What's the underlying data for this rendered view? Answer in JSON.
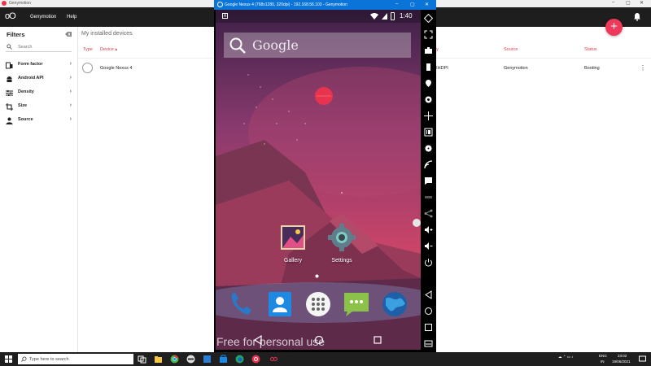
{
  "genymotion": {
    "window_title": "Genymotion",
    "brand": "oO",
    "menu": [
      "Genymotion",
      "Help"
    ],
    "sidebar": {
      "title": "Filters",
      "search_placeholder": "Search",
      "filters": [
        {
          "label": "Form factor",
          "icon": "phone-tablet-icon"
        },
        {
          "label": "Android API",
          "icon": "android-icon"
        },
        {
          "label": "Density",
          "icon": "sliders-icon"
        },
        {
          "label": "Size",
          "icon": "crop-icon"
        },
        {
          "label": "Source",
          "icon": "person-icon"
        }
      ]
    },
    "main": {
      "heading": "My installed devices",
      "columns": {
        "type": "Type",
        "device": "Device ▴",
        "density": "y",
        "source": "Source",
        "status": "Status"
      },
      "rows": [
        {
          "device": "Google Nexus 4",
          "density": "XHDPI",
          "source": "Genymotion",
          "status": "Booting"
        }
      ]
    },
    "fab_label": "+",
    "accent_color": "#f0385a"
  },
  "emulator": {
    "window_title": "Google Nexus 4 (768x1280, 320dpi) - 192.168.56.103 - Genymotion",
    "title_bar_color": "#0a74d8",
    "status_time": "1:40",
    "search_text": "Google",
    "apps": [
      {
        "label": "Gallery",
        "icon": "gallery-icon"
      },
      {
        "label": "Settings",
        "icon": "settings-gear-icon"
      }
    ],
    "dock": [
      "phone-icon",
      "contacts-icon",
      "app-drawer-icon",
      "messaging-icon",
      "browser-globe-icon"
    ],
    "watermark": "Free for personal use"
  },
  "taskbar": {
    "search_placeholder": "Type here to search",
    "lang_line1": "ENG",
    "lang_line2": "IN",
    "time": "23:02",
    "date": "19/06/2021"
  }
}
